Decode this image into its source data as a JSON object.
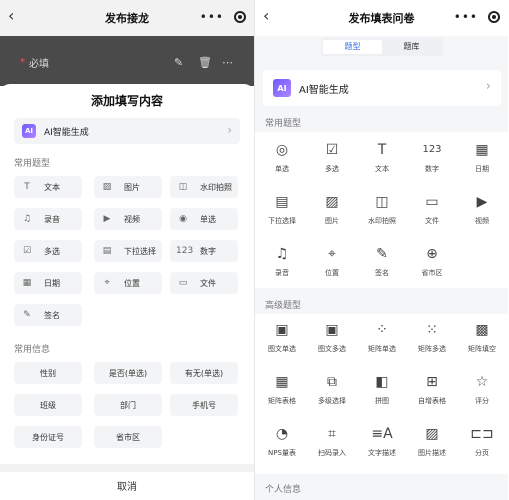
{
  "left": {
    "nav": {
      "title": "发布接龙",
      "more": "•••"
    },
    "behind_row": {
      "required_star": "*",
      "label": "必填"
    },
    "sheet": {
      "title": "添加填写内容",
      "ai": {
        "badge": "AI",
        "label": "AI智能生成"
      },
      "common_types_label": "常用题型",
      "types": [
        {
          "icon": "text-icon",
          "glyph": "T",
          "label": "文本"
        },
        {
          "icon": "image-icon",
          "glyph": "▨",
          "label": "图片"
        },
        {
          "icon": "watermark-icon",
          "glyph": "◫",
          "label": "水印拍照"
        },
        {
          "icon": "mic-icon",
          "glyph": "♫",
          "label": "录音"
        },
        {
          "icon": "video-icon",
          "glyph": "▶",
          "label": "视频"
        },
        {
          "icon": "radio-icon",
          "glyph": "◉",
          "label": "单选"
        },
        {
          "icon": "checkbox-icon",
          "glyph": "☑",
          "label": "多选"
        },
        {
          "icon": "dropdown-icon",
          "glyph": "▤",
          "label": "下拉选择"
        },
        {
          "icon": "number-icon",
          "glyph": "123",
          "label": "数字"
        },
        {
          "icon": "calendar-icon",
          "glyph": "▦",
          "label": "日期"
        },
        {
          "icon": "location-icon",
          "glyph": "⌖",
          "label": "位置"
        },
        {
          "icon": "file-icon",
          "glyph": "▭",
          "label": "文件"
        },
        {
          "icon": "signature-icon",
          "glyph": "✎",
          "label": "签名"
        }
      ],
      "common_info_label": "常用信息",
      "info": [
        "性别",
        "是否(单选)",
        "有无(单选)",
        "班级",
        "部门",
        "手机号",
        "身份证号",
        "省市区"
      ],
      "cancel": "取消"
    }
  },
  "right": {
    "nav": {
      "title": "发布填表问卷",
      "more": "•••"
    },
    "segment": {
      "active": "题型",
      "other": "题库"
    },
    "ai": {
      "badge": "AI",
      "label": "AI智能生成"
    },
    "common_label": "常用题型",
    "common": [
      {
        "icon": "radio-icon",
        "glyph": "◎",
        "label": "单选"
      },
      {
        "icon": "checkbox-icon",
        "glyph": "☑",
        "label": "多选"
      },
      {
        "icon": "text-icon",
        "glyph": "T",
        "label": "文本"
      },
      {
        "icon": "number-icon",
        "glyph": "123",
        "label": "数字"
      },
      {
        "icon": "calendar-icon",
        "glyph": "▦",
        "label": "日期"
      },
      {
        "icon": "dropdown-icon",
        "glyph": "▤",
        "label": "下拉选择"
      },
      {
        "icon": "image-icon",
        "glyph": "▨",
        "label": "图片"
      },
      {
        "icon": "watermark-icon",
        "glyph": "◫",
        "label": "水印拍照"
      },
      {
        "icon": "file-icon",
        "glyph": "▭",
        "label": "文件"
      },
      {
        "icon": "video-icon",
        "glyph": "▶",
        "label": "视频"
      },
      {
        "icon": "mic-icon",
        "glyph": "♫",
        "label": "录音"
      },
      {
        "icon": "location-icon",
        "glyph": "⌖",
        "label": "位置"
      },
      {
        "icon": "signature-icon",
        "glyph": "✎",
        "label": "签名"
      },
      {
        "icon": "globe-icon",
        "glyph": "⊕",
        "label": "省市区"
      }
    ],
    "advanced_label": "高级题型",
    "advanced": [
      {
        "icon": "image-text-radio-icon",
        "glyph": "▣",
        "label": "图文单选"
      },
      {
        "icon": "image-text-multi-icon",
        "glyph": "▣",
        "label": "图文多选"
      },
      {
        "icon": "matrix-radio-icon",
        "glyph": "⁘",
        "label": "矩阵单选"
      },
      {
        "icon": "matrix-multi-icon",
        "glyph": "⁙",
        "label": "矩阵多选"
      },
      {
        "icon": "matrix-fill-icon",
        "glyph": "▩",
        "label": "矩阵填空"
      },
      {
        "icon": "matrix-table-icon",
        "glyph": "▦",
        "label": "矩阵表格"
      },
      {
        "icon": "multi-level-icon",
        "glyph": "⧉",
        "label": "多级选择"
      },
      {
        "icon": "puzzle-icon",
        "glyph": "◧",
        "label": "拼图"
      },
      {
        "icon": "auto-table-icon",
        "glyph": "⊞",
        "label": "自增表格"
      },
      {
        "icon": "star-icon",
        "glyph": "☆",
        "label": "评分"
      },
      {
        "icon": "nps-icon",
        "glyph": "◔",
        "label": "NPS量表"
      },
      {
        "icon": "scan-icon",
        "glyph": "⌗",
        "label": "扫码录入"
      },
      {
        "icon": "text-desc-icon",
        "glyph": "≡A",
        "label": "文字描述"
      },
      {
        "icon": "image-desc-icon",
        "glyph": "▨",
        "label": "图片描述"
      },
      {
        "icon": "page-break-icon",
        "glyph": "⊏⊐",
        "label": "分页"
      }
    ],
    "personal_label": "个人信息"
  }
}
